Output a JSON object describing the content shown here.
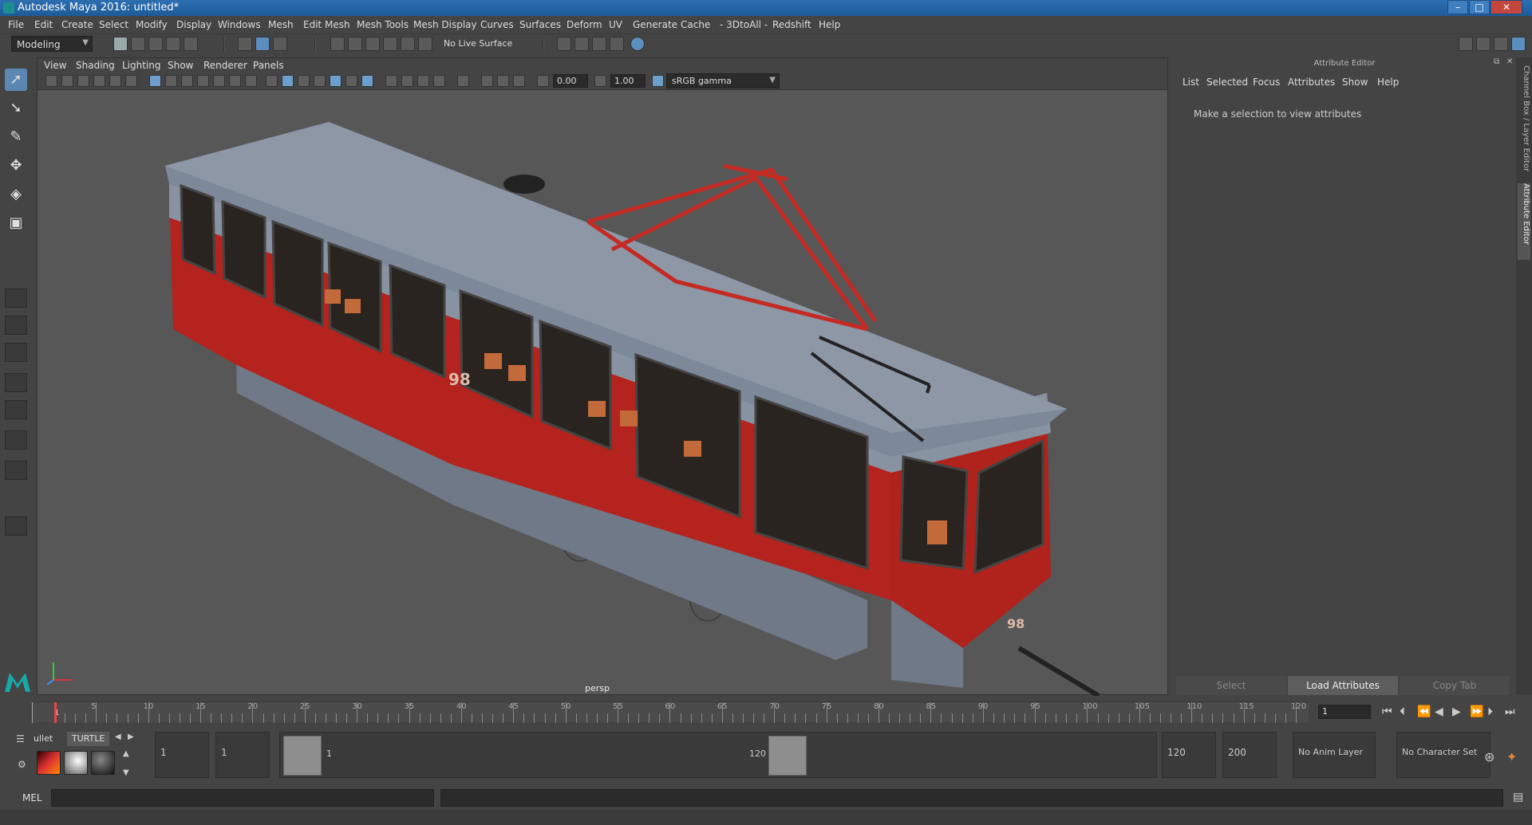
{
  "window": {
    "title": "Autodesk Maya 2016: untitled*",
    "controls": {
      "minimize": "–",
      "maximize": "□",
      "close": "✕"
    }
  },
  "menubar": [
    "File",
    "Edit",
    "Create",
    "Select",
    "Modify",
    "Display",
    "Windows",
    "Mesh",
    "Edit Mesh",
    "Mesh Tools",
    "Mesh Display",
    "Curves",
    "Surfaces",
    "Deform",
    "UV",
    "Generate",
    "Cache",
    "- 3DtoAll -",
    "Redshift",
    "Help"
  ],
  "statusline": {
    "mode": "Modeling",
    "live_surface": "No Live Surface"
  },
  "viewport": {
    "menu": [
      "View",
      "Shading",
      "Lighting",
      "Show",
      "Renderer",
      "Panels"
    ],
    "exposure": "0.00",
    "gamma": "1.00",
    "color_space": "sRGB gamma",
    "camera_label": "persp",
    "tram_number": "98"
  },
  "attribute_editor": {
    "header": "Attribute Editor",
    "menu": [
      "List",
      "Selected",
      "Focus",
      "Attributes",
      "Show",
      "Help"
    ],
    "message": "Make a selection to view attributes",
    "buttons": [
      "Select",
      "Load Attributes",
      "Copy Tab"
    ],
    "side_tabs": [
      "Channel Box / Layer Editor",
      "Attribute Editor"
    ]
  },
  "timeslider": {
    "ticks": [
      "5",
      "10",
      "15",
      "20",
      "25",
      "30",
      "35",
      "40",
      "45",
      "50",
      "55",
      "60",
      "65",
      "70",
      "75",
      "80",
      "85",
      "90",
      "95",
      "100",
      "105",
      "110",
      "115",
      "120"
    ],
    "current_frame": "1",
    "current_frame_field": "1"
  },
  "range": {
    "start": "1",
    "playback_start": "1",
    "range_start_label": "1",
    "range_end_label": "120",
    "playback_end": "120",
    "end": "200",
    "anim_layer": "No Anim Layer",
    "character_set": "No Character Set"
  },
  "shelf": {
    "tabs": [
      "ullet",
      "TURTLE"
    ]
  },
  "cmdline": {
    "label": "MEL"
  },
  "colors": {
    "accent": "#5d87b3",
    "tram_red": "#b4231d",
    "tram_roof": "#7d8898",
    "pantograph": "#c42a22"
  }
}
